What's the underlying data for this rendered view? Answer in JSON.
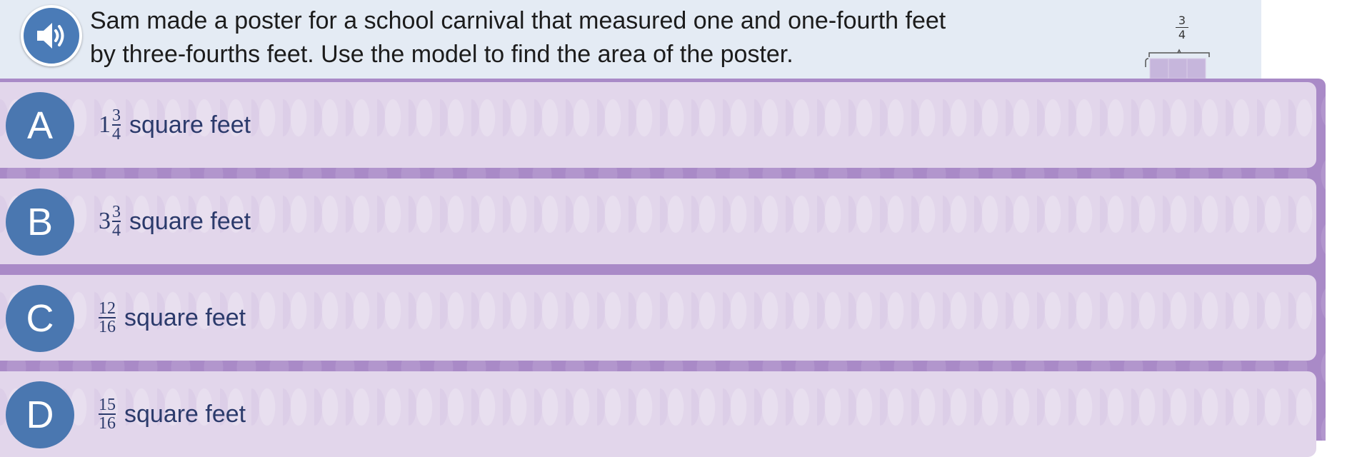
{
  "question": {
    "line1": "Sam made a poster for a school carnival that measured one and one-fourth feet",
    "line2": "by three-fourths feet. Use the model to find the area of the poster.",
    "audio_icon": "speaker-icon",
    "model_label": {
      "numerator": "3",
      "denominator": "4"
    }
  },
  "choices": [
    {
      "letter": "A",
      "whole": "1",
      "numerator": "3",
      "denominator": "4",
      "unit": "square feet"
    },
    {
      "letter": "B",
      "whole": "3",
      "numerator": "3",
      "denominator": "4",
      "unit": "square feet"
    },
    {
      "letter": "C",
      "whole": "",
      "numerator": "12",
      "denominator": "16",
      "unit": "square feet"
    },
    {
      "letter": "D",
      "whole": "",
      "numerator": "15",
      "denominator": "16",
      "unit": "square feet"
    }
  ],
  "colors": {
    "question_bg": "#e4ebf4",
    "letter_circle": "#4a77b0",
    "choice_bg": "#e2d6eb",
    "choice_border": "#a98ac7",
    "answer_text": "#2b3a6b"
  }
}
